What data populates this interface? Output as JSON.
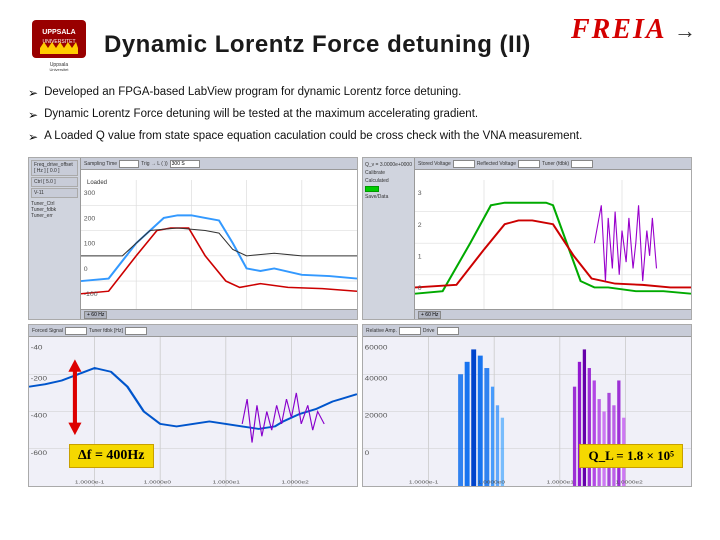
{
  "slide": {
    "title": "Dynamic Lorentz Force detuning (II)",
    "freia_label": "FREIA",
    "bullets": [
      "Developed an FPGA-based LabView program for dynamic Lorentz force detuning.",
      "Dynamic Lorentz Force detuning will be tested at the maximum accelerating gradient.",
      "A Loaded Q value from state space equation caculation could be cross check with the VNA measurement."
    ],
    "formula_bl": "Δf = 400Hz",
    "formula_br": "Q_L = 1.8 × 10⁵",
    "loaded_text": "Loaded"
  },
  "controls": {
    "btn1": "Calibrate",
    "btn2": "Save/Data",
    "field1": "300 S",
    "field2": "Q_v = 3.0000e + 0000",
    "label_loaded": "Loaded"
  },
  "panels": {
    "tl_label": "Top-left waveform panel",
    "tr_label": "Top-right waveform panel",
    "bl_label": "Bottom-left frequency deviation panel",
    "br_label": "Bottom-right Q-factor panel"
  }
}
